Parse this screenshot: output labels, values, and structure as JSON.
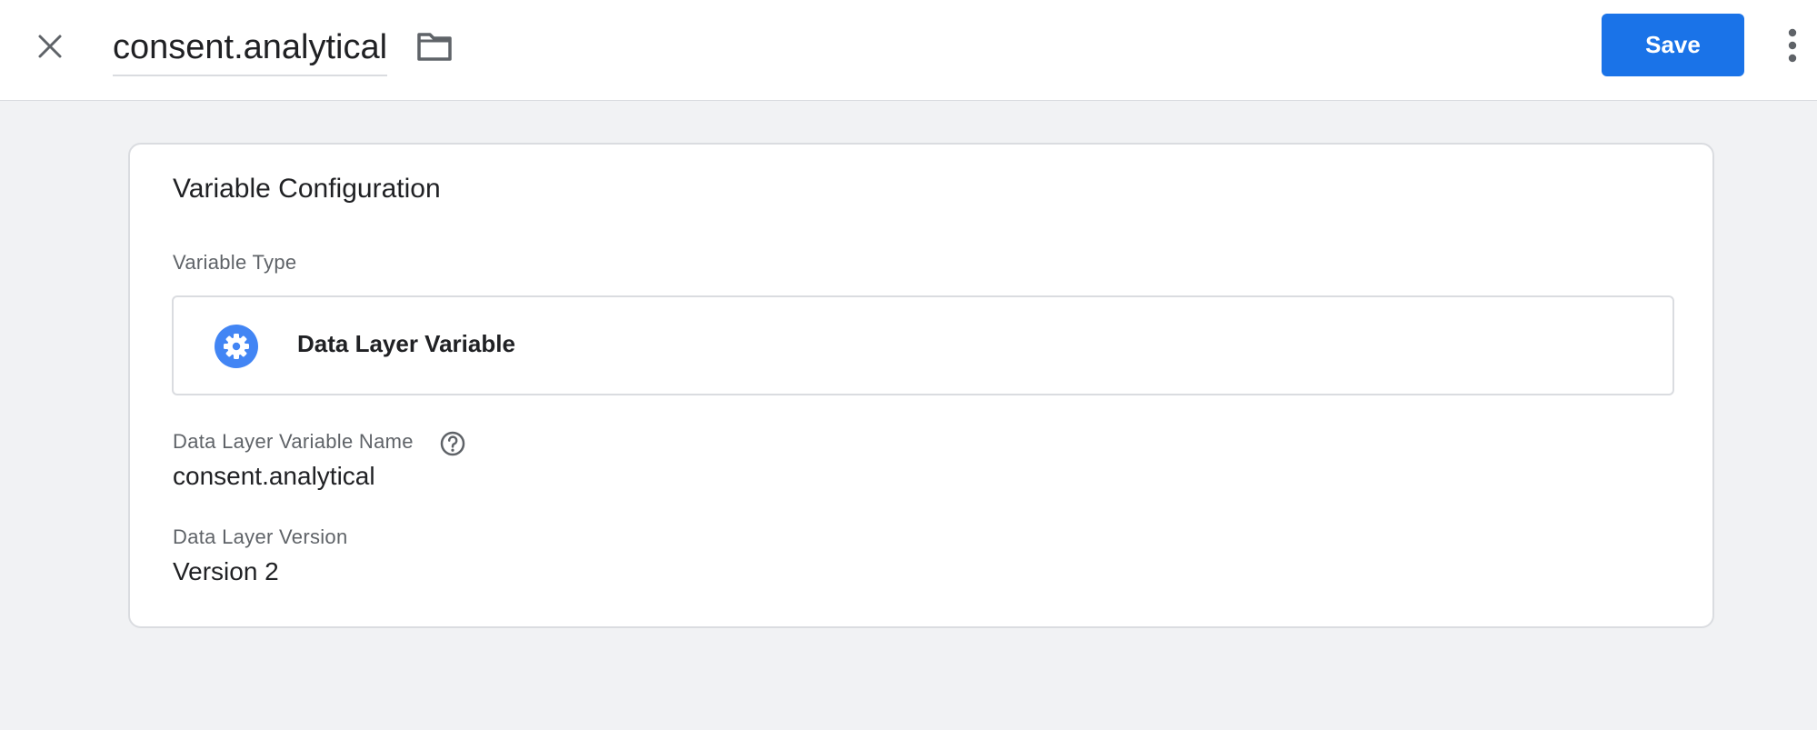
{
  "header": {
    "title": "consent.analytical",
    "save_label": "Save",
    "icons": {
      "close": "close-icon",
      "folder": "folder-icon",
      "more": "more-vert-icon"
    }
  },
  "card": {
    "title": "Variable Configuration",
    "variable_type_label": "Variable Type",
    "variable_type": {
      "name": "Data Layer Variable",
      "icon": "gear-icon",
      "icon_color": "#4285f4"
    },
    "name_field": {
      "label": "Data Layer Variable Name",
      "value": "consent.analytical",
      "help_icon": "help-icon"
    },
    "version_field": {
      "label": "Data Layer Version",
      "value": "Version 2"
    }
  },
  "colors": {
    "accent": "#1a73e8",
    "background": "#f1f2f4"
  }
}
